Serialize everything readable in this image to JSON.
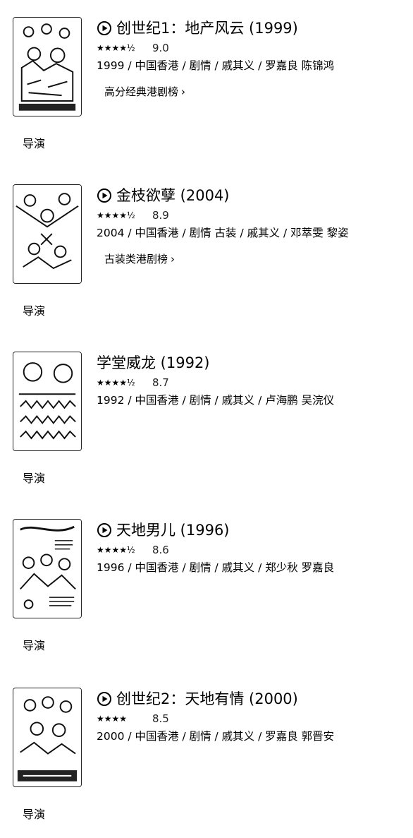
{
  "movies": [
    {
      "title": "创世纪1：地产风云 (1999)",
      "has_play": true,
      "stars": "★★★★½",
      "score": "9.0",
      "meta": "1999 / 中国香港 / 剧情 / 戚其义 / 罗嘉良 陈锦鸿",
      "rank": "高分经典港剧榜",
      "director_label": "导演"
    },
    {
      "title": "金枝欲孽 (2004)",
      "has_play": true,
      "stars": "★★★★½",
      "score": "8.9",
      "meta": "2004 / 中国香港 / 剧情 古装 / 戚其义 / 邓萃雯 黎姿",
      "rank": "古装类港剧榜",
      "director_label": "导演"
    },
    {
      "title": "学堂威龙 (1992)",
      "has_play": false,
      "stars": "★★★★½",
      "score": "8.7",
      "meta": "1992 / 中国香港 / 剧情 / 戚其义 / 卢海鹏 吴浣仪",
      "rank": "",
      "director_label": "导演"
    },
    {
      "title": "天地男儿 (1996)",
      "has_play": true,
      "stars": "★★★★½",
      "score": "8.6",
      "meta": "1996 / 中国香港 / 剧情 / 戚其义 / 郑少秋 罗嘉良",
      "rank": "",
      "director_label": "导演"
    },
    {
      "title": "创世纪2：天地有情 (2000)",
      "has_play": true,
      "stars": "★★★★",
      "score": "8.5",
      "meta": "2000 / 中国香港 / 剧情 / 戚其义 / 罗嘉良 郭晋安",
      "rank": "",
      "director_label": "导演"
    }
  ],
  "icons": {
    "play": "play-circle-icon",
    "chevron": "chevron-right-icon"
  },
  "colors": {
    "text": "#000000",
    "background": "#ffffff"
  }
}
